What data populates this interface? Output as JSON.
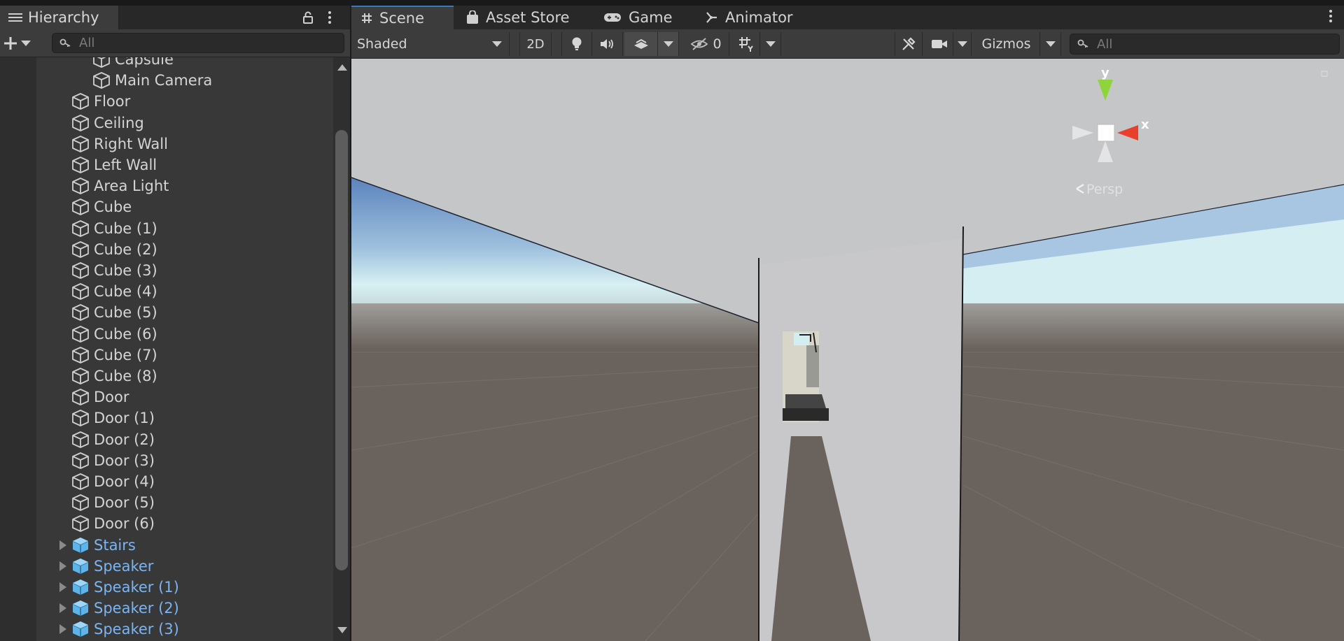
{
  "hierarchy": {
    "tab_label": "Hierarchy",
    "search_placeholder": "All",
    "items": [
      {
        "label": "Capsule",
        "prefab": false,
        "expandable": false
      },
      {
        "label": "Main Camera",
        "prefab": false,
        "expandable": false
      },
      {
        "label": "Floor",
        "prefab": false,
        "expandable": false
      },
      {
        "label": "Ceiling",
        "prefab": false,
        "expandable": false
      },
      {
        "label": "Right Wall",
        "prefab": false,
        "expandable": false
      },
      {
        "label": "Left Wall",
        "prefab": false,
        "expandable": false
      },
      {
        "label": "Area Light",
        "prefab": false,
        "expandable": false
      },
      {
        "label": "Cube",
        "prefab": false,
        "expandable": false
      },
      {
        "label": "Cube (1)",
        "prefab": false,
        "expandable": false
      },
      {
        "label": "Cube (2)",
        "prefab": false,
        "expandable": false
      },
      {
        "label": "Cube (3)",
        "prefab": false,
        "expandable": false
      },
      {
        "label": "Cube (4)",
        "prefab": false,
        "expandable": false
      },
      {
        "label": "Cube (5)",
        "prefab": false,
        "expandable": false
      },
      {
        "label": "Cube (6)",
        "prefab": false,
        "expandable": false
      },
      {
        "label": "Cube (7)",
        "prefab": false,
        "expandable": false
      },
      {
        "label": "Cube (8)",
        "prefab": false,
        "expandable": false
      },
      {
        "label": "Door",
        "prefab": false,
        "expandable": false
      },
      {
        "label": "Door (1)",
        "prefab": false,
        "expandable": false
      },
      {
        "label": "Door (2)",
        "prefab": false,
        "expandable": false
      },
      {
        "label": "Door (3)",
        "prefab": false,
        "expandable": false
      },
      {
        "label": "Door (4)",
        "prefab": false,
        "expandable": false
      },
      {
        "label": "Door (5)",
        "prefab": false,
        "expandable": false
      },
      {
        "label": "Door (6)",
        "prefab": false,
        "expandable": false
      },
      {
        "label": "Stairs",
        "prefab": true,
        "expandable": true
      },
      {
        "label": "Speaker",
        "prefab": true,
        "expandable": true
      },
      {
        "label": "Speaker (1)",
        "prefab": true,
        "expandable": true
      },
      {
        "label": "Speaker (2)",
        "prefab": true,
        "expandable": true
      },
      {
        "label": "Speaker (3)",
        "prefab": true,
        "expandable": true
      }
    ]
  },
  "scene": {
    "tabs": [
      {
        "label": "Scene",
        "icon": "grid-icon",
        "active": true
      },
      {
        "label": "Asset Store",
        "icon": "shopping-bag-icon",
        "active": false
      },
      {
        "label": "Game",
        "icon": "gamepad-icon",
        "active": false
      },
      {
        "label": "Animator",
        "icon": "animator-icon",
        "active": false
      }
    ],
    "toolbar": {
      "draw_mode": "Shaded",
      "two_d_label": "2D",
      "hidden_count": "0",
      "gizmos_label": "Gizmos",
      "search_placeholder": "All"
    },
    "gizmo": {
      "y_label": "y",
      "x_label": "x",
      "projection_label": "Persp"
    }
  },
  "colors": {
    "prefab_text": "#7bb4f0",
    "accent_tab": "#3a79bb",
    "gizmo_y": "#8fd43a",
    "gizmo_x": "#e8402a",
    "panel_bg": "#383838"
  }
}
